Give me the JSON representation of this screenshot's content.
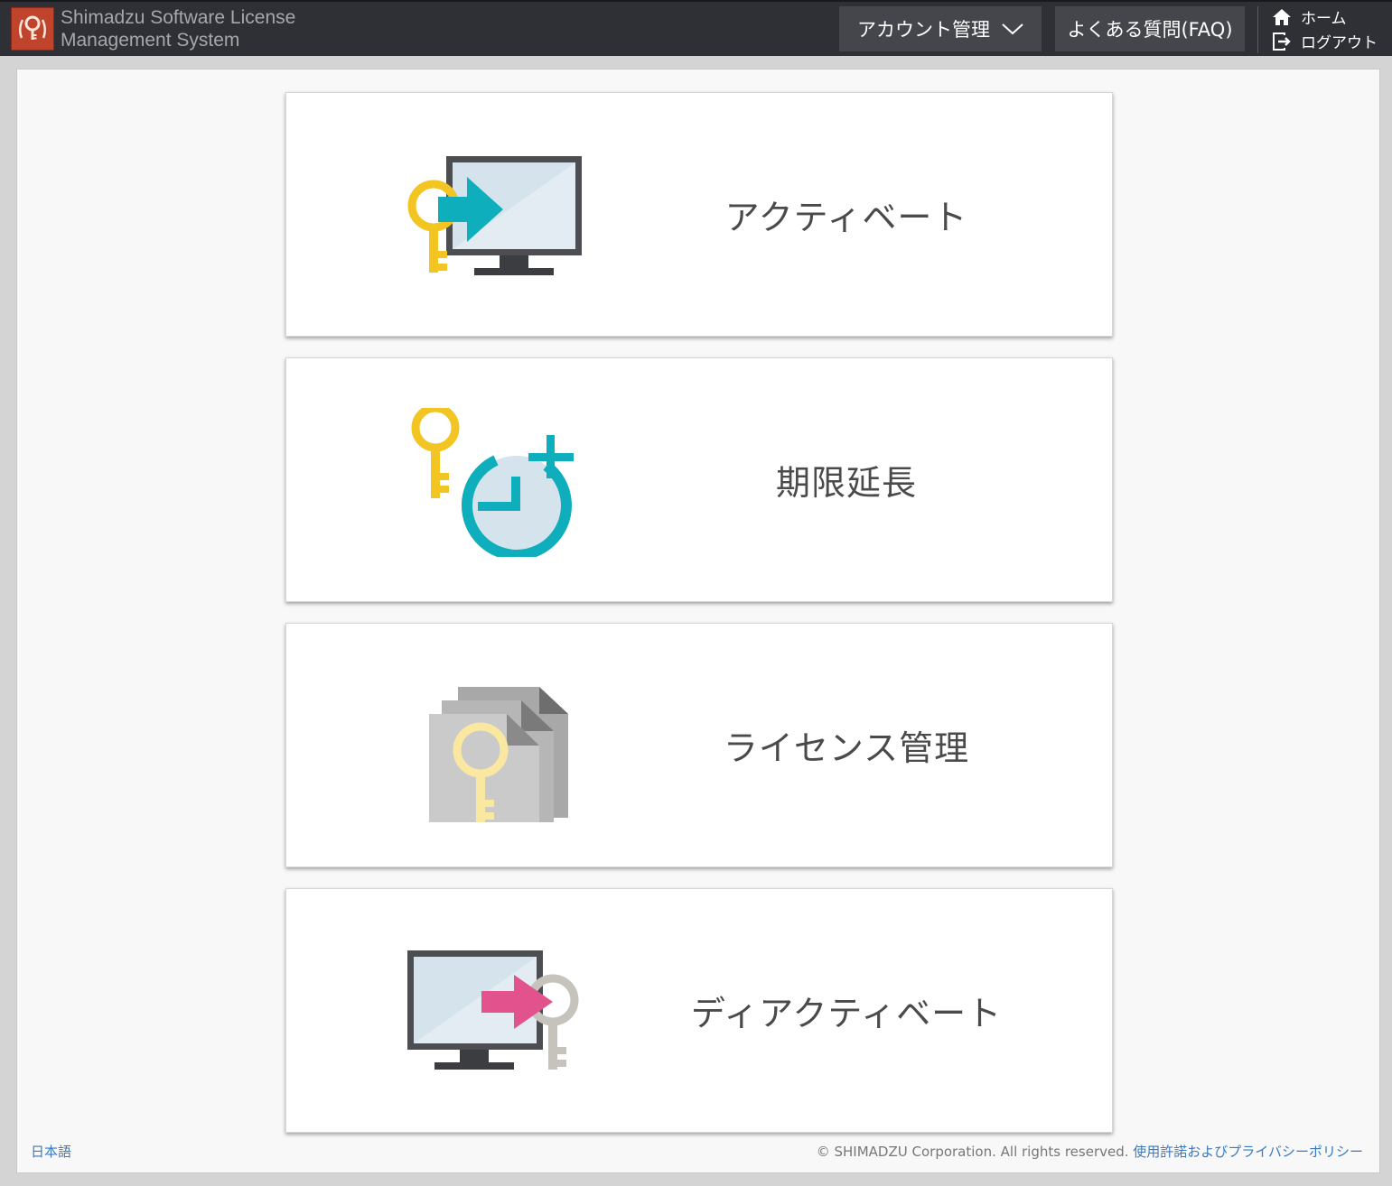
{
  "header": {
    "brand_line1": "Shimadzu Software License",
    "brand_line2": "Management System",
    "account_menu_label": "アカウント管理",
    "faq_label": "よくある質問(FAQ)",
    "home_label": "ホーム",
    "logout_label": "ログアウト"
  },
  "tiles": [
    {
      "label": "アクティベート",
      "icon": "key-to-monitor-icon"
    },
    {
      "label": "期限延長",
      "icon": "key-clock-plus-icon"
    },
    {
      "label": "ライセンス管理",
      "icon": "license-documents-icon"
    },
    {
      "label": "ディアクティベート",
      "icon": "monitor-to-key-icon"
    }
  ],
  "footer": {
    "language": "日本語",
    "copyright": "© SHIMADZU Corporation. All rights reserved.",
    "policy_link": "使用許諾およびプライバシーポリシー"
  },
  "colors": {
    "topbar": "#2f3035",
    "nav_button": "#45464b",
    "brand_red": "#c0442c",
    "key_yellow": "#f2c523",
    "teal": "#0eaebc",
    "pink": "#e2528d",
    "link_blue": "#3a7ac0"
  }
}
